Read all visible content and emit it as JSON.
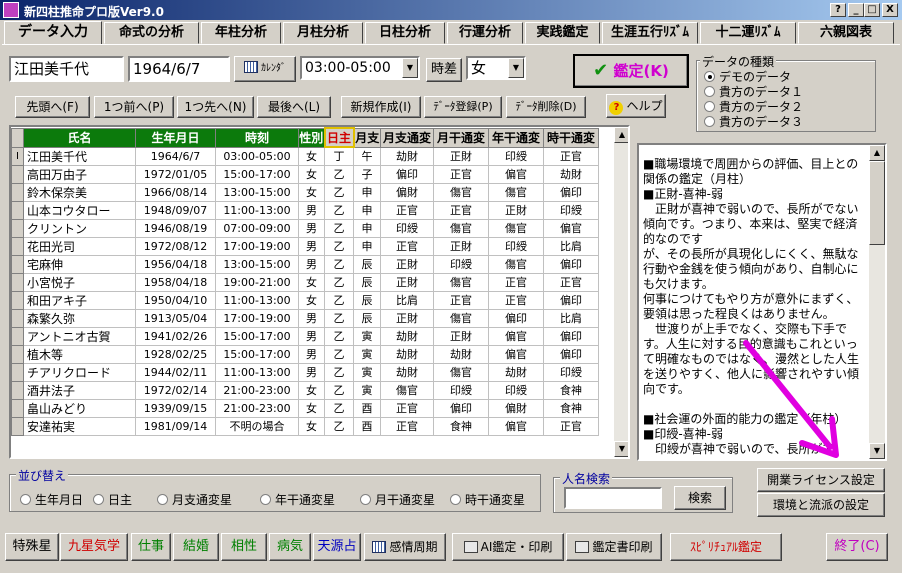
{
  "window": {
    "title": "新四柱推命プロ版Ver9.0",
    "help_button": "?",
    "minimize_button": "_",
    "maximize_button": "□",
    "close_button": "X"
  },
  "tabs": [
    {
      "label": "データ入力",
      "active": true
    },
    {
      "label": "命式の分析"
    },
    {
      "label": "年柱分析"
    },
    {
      "label": "月柱分析"
    },
    {
      "label": "日柱分析"
    },
    {
      "label": "行運分析"
    },
    {
      "label": "実践鑑定"
    },
    {
      "label": "生涯五行ﾘｽﾞﾑ"
    },
    {
      "label": "十二運ﾘｽﾞﾑ"
    },
    {
      "label": "六親図表"
    }
  ],
  "form": {
    "name_value": "江田美千代",
    "birthdate_value": "1964/6/7",
    "calendar_button": "ｶﾚﾝﾀﾞ",
    "time_value": "03:00-05:00",
    "jisa_button": "時差",
    "gender_value": "女",
    "kantei_button": "鑑定(K)"
  },
  "data_type": {
    "legend": "データの種類",
    "options": [
      {
        "label": "デモのデータ",
        "selected": true
      },
      {
        "label": "貴方のデータ１",
        "selected": false
      },
      {
        "label": "貴方のデータ２",
        "selected": false
      },
      {
        "label": "貴方のデータ３",
        "selected": false
      }
    ]
  },
  "nav": {
    "first": "先頭へ(F)",
    "prev": "1つ前へ(P)",
    "next": "1つ先へ(N)",
    "last": "最後へ(L)",
    "new": "新規作成(I)",
    "register": "ﾃﾞｰﾀ登録(P)",
    "delete": "ﾃﾞｰﾀ削除(D)",
    "help": "ヘルプ"
  },
  "table": {
    "headers": [
      "氏名",
      "生年月日",
      "時刻",
      "性別",
      "日主",
      "月支",
      "月支通変",
      "月干通変",
      "年干通変",
      "時干通変"
    ],
    "indicator": "I",
    "rows": [
      [
        "江田美千代",
        "1964/6/7",
        "03:00-05:00",
        "女",
        "丁",
        "午",
        "劫財",
        "正財",
        "印綬",
        "正官"
      ],
      [
        "高田万由子",
        "1972/01/05",
        "15:00-17:00",
        "女",
        "乙",
        "子",
        "偏印",
        "正官",
        "偏官",
        "劫財"
      ],
      [
        "鈴木保奈美",
        "1966/08/14",
        "13:00-15:00",
        "女",
        "乙",
        "申",
        "偏財",
        "傷官",
        "傷官",
        "偏印"
      ],
      [
        "山本コウタロー",
        "1948/09/07",
        "11:00-13:00",
        "男",
        "乙",
        "申",
        "正官",
        "正官",
        "正財",
        "印綬"
      ],
      [
        "クリントン",
        "1946/08/19",
        "07:00-09:00",
        "男",
        "乙",
        "申",
        "印綬",
        "傷官",
        "傷官",
        "偏官"
      ],
      [
        "花田光司",
        "1972/08/12",
        "17:00-19:00",
        "男",
        "乙",
        "申",
        "正官",
        "正財",
        "印綬",
        "比肩"
      ],
      [
        "宅麻伸",
        "1956/04/18",
        "13:00-15:00",
        "男",
        "乙",
        "辰",
        "正財",
        "印綬",
        "傷官",
        "偏印"
      ],
      [
        "小宮悦子",
        "1958/04/18",
        "19:00-21:00",
        "女",
        "乙",
        "辰",
        "正財",
        "傷官",
        "正官",
        "正官"
      ],
      [
        "和田アキ子",
        "1950/04/10",
        "11:00-13:00",
        "女",
        "乙",
        "辰",
        "比肩",
        "正官",
        "正官",
        "偏印"
      ],
      [
        "森繁久弥",
        "1913/05/04",
        "17:00-19:00",
        "男",
        "乙",
        "辰",
        "正財",
        "傷官",
        "偏印",
        "比肩"
      ],
      [
        "アントニオ古賀",
        "1941/02/26",
        "15:00-17:00",
        "男",
        "乙",
        "寅",
        "劫財",
        "正財",
        "偏官",
        "偏印"
      ],
      [
        "植木等",
        "1928/02/25",
        "15:00-17:00",
        "男",
        "乙",
        "寅",
        "劫財",
        "劫財",
        "偏官",
        "偏印"
      ],
      [
        "チアリクロード",
        "1944/02/11",
        "11:00-13:00",
        "男",
        "乙",
        "寅",
        "劫財",
        "傷官",
        "劫財",
        "印綬"
      ],
      [
        "酒井法子",
        "1972/02/14",
        "21:00-23:00",
        "女",
        "乙",
        "寅",
        "傷官",
        "印綬",
        "印綬",
        "食神"
      ],
      [
        "畠山みどり",
        "1939/09/15",
        "21:00-23:00",
        "女",
        "乙",
        "酉",
        "正官",
        "偏印",
        "偏財",
        "食神"
      ],
      [
        "安達祐実",
        "1981/09/14",
        "不明の場合",
        "女",
        "乙",
        "酉",
        "正官",
        "食神",
        "偏官",
        "正官"
      ]
    ]
  },
  "text_panel": {
    "content": "■職場環境で周囲からの評価、目上との関係の鑑定（月柱）\n■正財-喜神-弱\n　正財が喜神で弱いので、長所がでない傾向です。つまり、本来は、堅実で経済的なのです\nが、その長所が具現化しにくく、無駄な行動や金銭を使う傾向があり、自制心にも欠けます。\n何事につけてもやり方が意外にまずく、要領は思った程良くはありません。\n　世渡りが上手でなく、交際も下手です。人生に対する目的意識もこれといって明確なものではなく、漫然とした人生を送りやすく、他人に影響されやすい傾向です。\n\n■社会運の外面的能力の鑑定（年柱）\n■印綬-喜神-弱\n　印綬が喜神で弱いので、長所がで"
  },
  "sort": {
    "legend": "並び替え",
    "options": [
      {
        "label": "生年月日",
        "selected": false
      },
      {
        "label": "日主",
        "selected": false
      },
      {
        "label": "月支通変星",
        "selected": false
      },
      {
        "label": "年干通変星",
        "selected": false
      },
      {
        "label": "月干通変星",
        "selected": false
      },
      {
        "label": "時干通変星",
        "selected": false
      }
    ]
  },
  "name_search": {
    "legend": "人名検索",
    "input_value": "",
    "search_button": "検索"
  },
  "license_button": "開業ライセンス設定",
  "env_button": "環境と流派の設定",
  "bottom": {
    "tokusyusei": "特殊星",
    "kyusei": "九星気学",
    "shigoto": "仕事",
    "kekkon": "結婚",
    "aisho": "相性",
    "byoki": "病気",
    "tengen": "天源占",
    "kanjo": "感情周期",
    "ai": "AI鑑定・印刷",
    "kanteisho": "鑑定書印刷",
    "spiritual": "ｽﾋﾟﾘﾁｭｱﾙ鑑定",
    "exit": "終了(C)"
  },
  "colors": {
    "header_green": "#0c7a0c",
    "kyusei_red": "#d00000",
    "shigoto_green": "#008000",
    "kekkon_green": "#008000",
    "aisho_green": "#008000",
    "byoki_green": "#008000",
    "tengen_blue": "#0000c0",
    "spiritual_red": "#d00000",
    "exit_magenta": "#c000c0",
    "arrow_magenta": "#e000e0"
  }
}
